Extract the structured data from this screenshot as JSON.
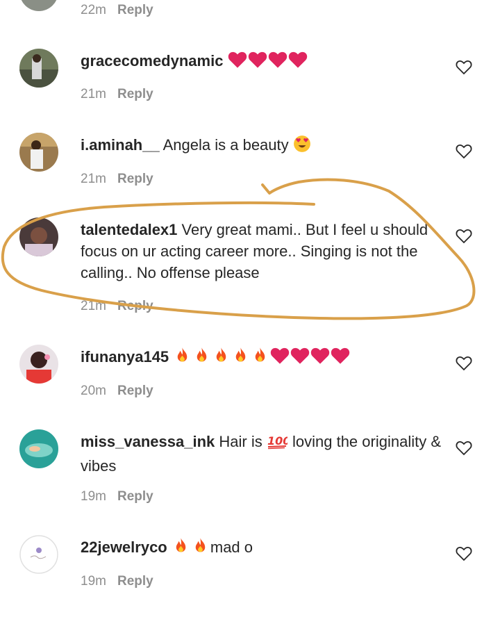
{
  "top_partial": {
    "time": "22m",
    "reply": "Reply"
  },
  "comments": [
    {
      "username": "gracecomedynamic",
      "text": "",
      "emoji": [
        "heart",
        "heart",
        "heart",
        "heart"
      ],
      "text_after": "",
      "time": "21m",
      "reply": "Reply"
    },
    {
      "username": "i.aminah__",
      "text": "Angela is a beauty",
      "emoji": [
        "heart-eyes"
      ],
      "text_after": "",
      "time": "21m",
      "reply": "Reply"
    },
    {
      "username": "talentedalex1",
      "text": "Very great mami.. But I feel u should focus on ur acting career more.. Singing is not the calling.. No offense please",
      "emoji": [],
      "text_after": "",
      "time": "21m",
      "reply": "Reply"
    },
    {
      "username": "ifunanya145",
      "text": "",
      "emoji": [
        "fire",
        "fire",
        "fire",
        "fire",
        "fire",
        "heart",
        "heart",
        "heart",
        "heart"
      ],
      "text_after": "",
      "time": "20m",
      "reply": "Reply"
    },
    {
      "username": "miss_vanessa_ink",
      "text": "Hair is",
      "emoji": [
        "hundred"
      ],
      "text_after": "loving the originality & vibes",
      "time": "19m",
      "reply": "Reply"
    },
    {
      "username": "22jewelryco",
      "text": "",
      "emoji": [
        "fire",
        "fire"
      ],
      "text_after": "mad o",
      "time": "19m",
      "reply": "Reply"
    }
  ],
  "colors": {
    "annotation": "#d9a04a",
    "meta": "#8e8e8e",
    "heart": "#e0245e",
    "fire": "#f4511e"
  },
  "icons": {
    "like": "heart-outline-icon",
    "avatar": "avatar-image"
  }
}
